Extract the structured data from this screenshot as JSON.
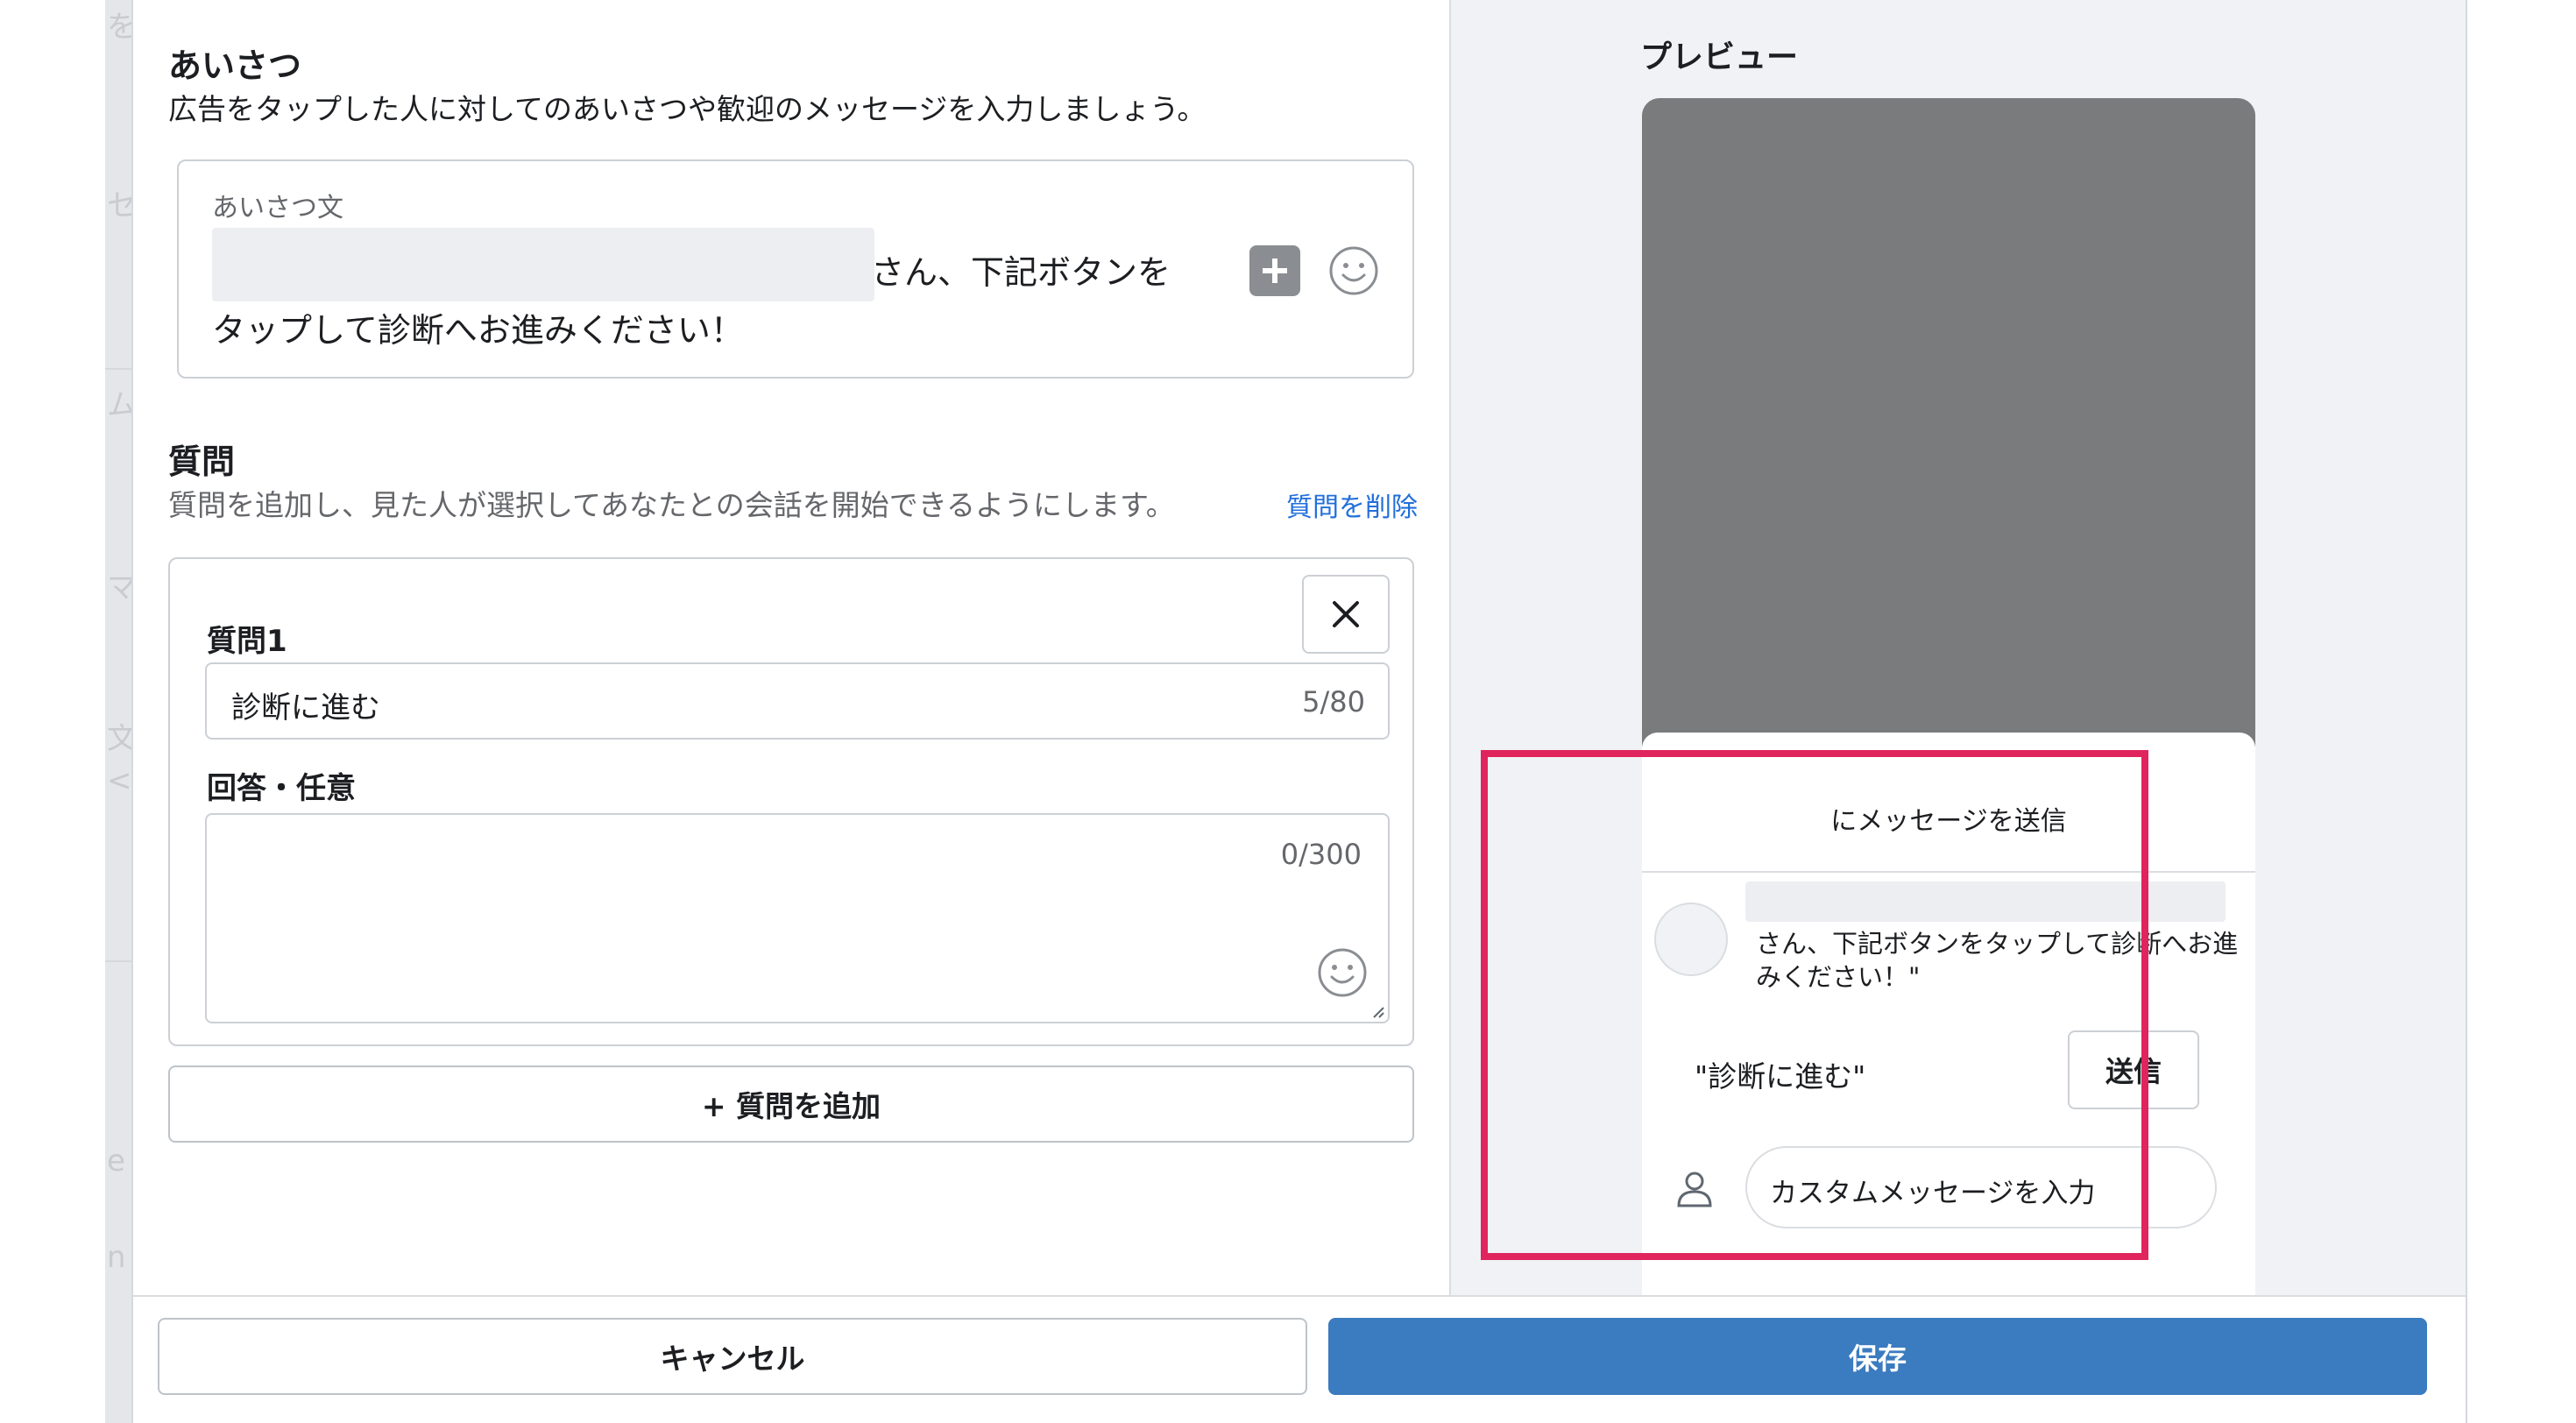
{
  "background": {
    "fragments": [
      "を",
      "セ",
      "ム",
      "マ",
      "文",
      "<",
      "e",
      "n"
    ]
  },
  "greeting": {
    "title": "あいさつ",
    "description": "広告をタップした人に対してのあいさつや歓迎のメッセージを入力しましょう。",
    "field_label": "あいさつ文",
    "line1": "さん、下記ボタンを",
    "line2": "タップして診断へお進みください！",
    "add_icon": "plus-square-icon",
    "emoji_icon": "smiley-icon"
  },
  "questions": {
    "title": "質問",
    "description": "質問を追加し、見た人が選択してあなたとの会話を開始できるようにします。",
    "delete_link": "質問を削除",
    "items": [
      {
        "label": "質問1",
        "value": "診断に進む",
        "counter": "5/80",
        "answer_label": "回答・任意",
        "answer_counter": "0/300"
      }
    ],
    "add_button": "+ 質問を追加"
  },
  "preview": {
    "title": "プレビュー",
    "card_header": "にメッセージを送信",
    "message": "さん、下記ボタンをタップして診断へお進みください！\"",
    "quick_reply": "\"診断に進む\"",
    "send_button": "送信",
    "custom_placeholder": "カスタムメッセージを入力",
    "highlight_color": "#e0245e"
  },
  "footer": {
    "cancel": "キャンセル",
    "save": "保存",
    "save_color": "#3b7bbf"
  }
}
